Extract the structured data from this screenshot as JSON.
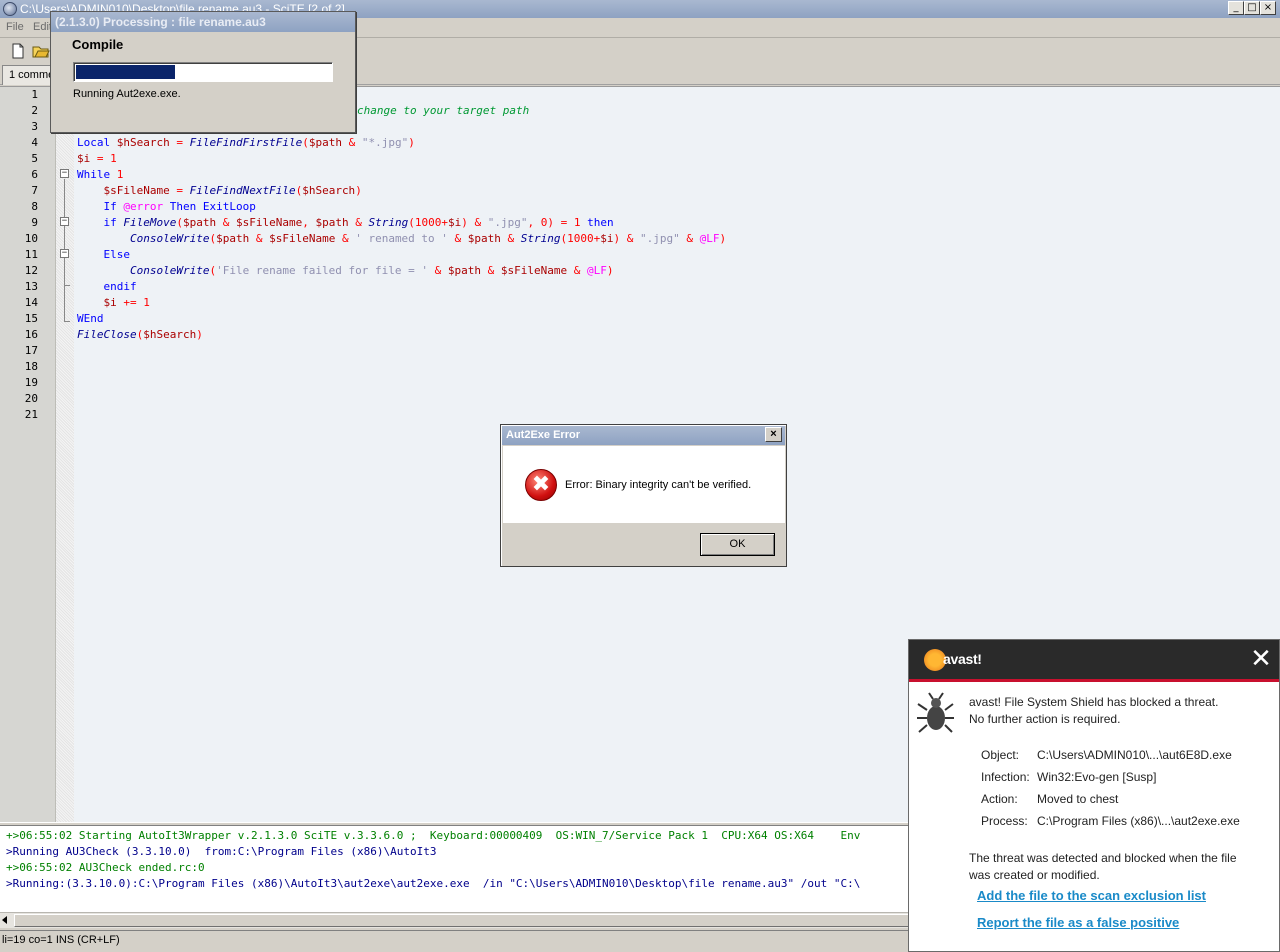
{
  "window": {
    "title": "C:\\Users\\ADMIN010\\Desktop\\file rename.au3 - SciTE [2 of 2]",
    "min_glyph": "_",
    "max_glyph": "□",
    "close_glyph": "×"
  },
  "menu": {
    "file": "File",
    "edit": "Edit"
  },
  "tab": {
    "label": "1 comme"
  },
  "editor": {
    "line_numbers": [
      "1",
      "2",
      "3",
      "4",
      "5",
      "6",
      "7",
      "8",
      "9",
      "10",
      "11",
      "12",
      "13",
      "14",
      "15",
      "16",
      "17",
      "18",
      "19",
      "20",
      "21"
    ],
    "line2_comment": "change to your target path"
  },
  "output": {
    "lines": [
      {
        "text": "+>06:55:02 Starting AutoIt3Wrapper v.2.1.3.0 SciTE v.3.3.6.0 ;  Keyboard:00000409  OS:WIN_7/Service Pack 1  CPU:X64 OS:X64    Env",
        "color": "#008000"
      },
      {
        "text": ">Running AU3Check (3.3.10.0)  from:C:\\Program Files (x86)\\AutoIt3",
        "color": "#00008b"
      },
      {
        "text": "+>06:55:02 AU3Check ended.rc:0",
        "color": "#008000"
      },
      {
        "text": ">Running:(3.3.10.0):C:\\Program Files (x86)\\AutoIt3\\aut2exe\\aut2exe.exe  /in \"C:\\Users\\ADMIN010\\Desktop\\file rename.au3\" /out \"C:\\",
        "color": "#00008b"
      }
    ]
  },
  "statusbar": {
    "text": "li=19 co=1 INS (CR+LF)"
  },
  "compile_window": {
    "title": "(2.1.3.0) Processing : file rename.au3",
    "heading": "Compile",
    "progress": 0.39,
    "status": "Running Aut2exe.exe."
  },
  "error_dialog": {
    "title": "Aut2Exe Error",
    "close": "×",
    "icon_glyph": "✖",
    "message": "Error: Binary integrity can't be verified.",
    "ok_label": "OK"
  },
  "avast": {
    "logo": "avast!",
    "close": "✕",
    "headline_1": "avast! File System Shield has blocked a threat.",
    "headline_2": "No further action is required.",
    "details": [
      {
        "label": "Object:",
        "value": "C:\\Users\\ADMIN010\\...\\aut6E8D.exe"
      },
      {
        "label": "Infection:",
        "value": "Win32:Evo-gen [Susp]"
      },
      {
        "label": "Action:",
        "value": "Moved to chest"
      },
      {
        "label": "Process:",
        "value": "C:\\Program Files (x86)\\...\\aut2exe.exe"
      }
    ],
    "note_1": "The threat was detected and blocked when the file",
    "note_2": "was created or modified.",
    "link_exclusion": "Add the file to the scan exclusion list",
    "link_false_positive": "Report the file as a false positive"
  },
  "colors": {
    "progress_fill": "#0a246a",
    "avast_accent": "#c8102e",
    "link": "#1a8ac8"
  }
}
